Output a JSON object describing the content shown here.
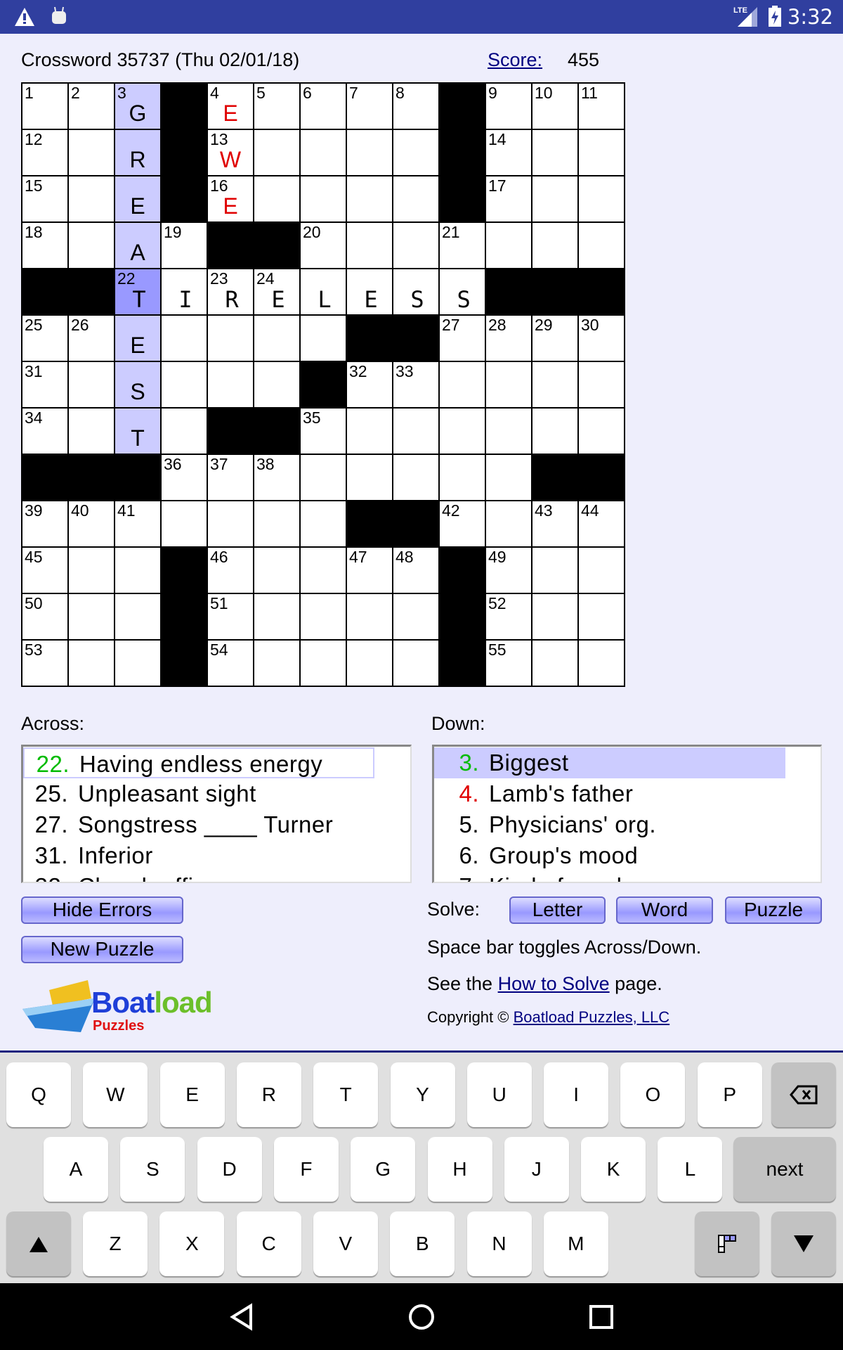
{
  "status_bar": {
    "time": "3:32",
    "network": "LTE",
    "icons": [
      "warning-icon",
      "android-icon",
      "signal-icon",
      "battery-charging-icon"
    ],
    "color": "#303f9f"
  },
  "header": {
    "title": "Crossword 35737 (Thu 02/01/18)",
    "score_label": "Score:",
    "score": "455"
  },
  "grid": {
    "layout": [
      "...#.....#...",
      "...#.....#...",
      "...#.....#...",
      "....##.......",
      "##........###",
      ".......##....",
      "......#......",
      "....##.......",
      "###........##",
      ".......##....",
      "...#.....#...",
      "...#.....#...",
      "...#.....#..."
    ],
    "letters": [
      "  G E        ",
      "  R W        ",
      "  E E        ",
      "  A          ",
      "  TIRELESS   ",
      "  E          ",
      "  S          ",
      "  T          ",
      "             ",
      "             ",
      "             ",
      "             ",
      "             "
    ],
    "error_cells": [
      [
        0,
        4
      ],
      [
        1,
        4
      ],
      [
        2,
        4
      ]
    ],
    "highlight_column": 2,
    "highlight_rows": [
      0,
      7
    ],
    "current_cell": [
      4,
      2
    ],
    "numbers": [
      1,
      2,
      3,
      4,
      5,
      6,
      7,
      8,
      9,
      10,
      11,
      12,
      13,
      14,
      15,
      16,
      17,
      18,
      19,
      20,
      21,
      22,
      23,
      24,
      25,
      26,
      27,
      28,
      29,
      30,
      31,
      32,
      33,
      34,
      35,
      36,
      37,
      38,
      39,
      40,
      41,
      42,
      43,
      44,
      45,
      46,
      47,
      48,
      49,
      50,
      51,
      52,
      53,
      54,
      55
    ],
    "colors": {
      "highlight": "#ccccff",
      "current": "#9999ff",
      "error": "#e00000"
    }
  },
  "across": {
    "label": "Across:",
    "clues": [
      {
        "n": "22.",
        "t": "Having endless energy",
        "color": "#00bb00"
      },
      {
        "n": "25.",
        "t": "Unpleasant sight"
      },
      {
        "n": "27.",
        "t": "Songstress ____ Turner"
      },
      {
        "n": "31.",
        "t": "Inferior"
      },
      {
        "n": "32.",
        "t": "Church officer"
      }
    ]
  },
  "down": {
    "label": "Down:",
    "clues": [
      {
        "n": "3.",
        "t": "Biggest",
        "color": "#00bb00"
      },
      {
        "n": "4.",
        "t": "Lamb's father",
        "color": "#e00000"
      },
      {
        "n": "5.",
        "t": "Physicians' org."
      },
      {
        "n": "6.",
        "t": "Group's mood"
      },
      {
        "n": "7.",
        "t": "Kind of number"
      }
    ]
  },
  "buttons": {
    "hide_errors": "Hide Errors",
    "new_puzzle": "New Puzzle",
    "solve_label": "Solve:",
    "letter": "Letter",
    "word": "Word",
    "puzzle": "Puzzle"
  },
  "info": {
    "toggle": "Space bar toggles Across/Down.",
    "see_pre": "See the ",
    "how_to": "How to Solve",
    "see_post": " page.",
    "copyright": "Copyright © ",
    "company": "Boatload Puzzles, LLC"
  },
  "logo": {
    "text1": "Boat",
    "text2": "load",
    "text3": "Puzzles"
  },
  "keyboard": {
    "row1": [
      "Q",
      "W",
      "E",
      "R",
      "T",
      "Y",
      "U",
      "I",
      "O",
      "P"
    ],
    "row2": [
      "A",
      "S",
      "D",
      "F",
      "G",
      "H",
      "J",
      "K",
      "L"
    ],
    "row3": [
      "Z",
      "X",
      "C",
      "V",
      "B",
      "N",
      "M"
    ],
    "next": "next"
  }
}
